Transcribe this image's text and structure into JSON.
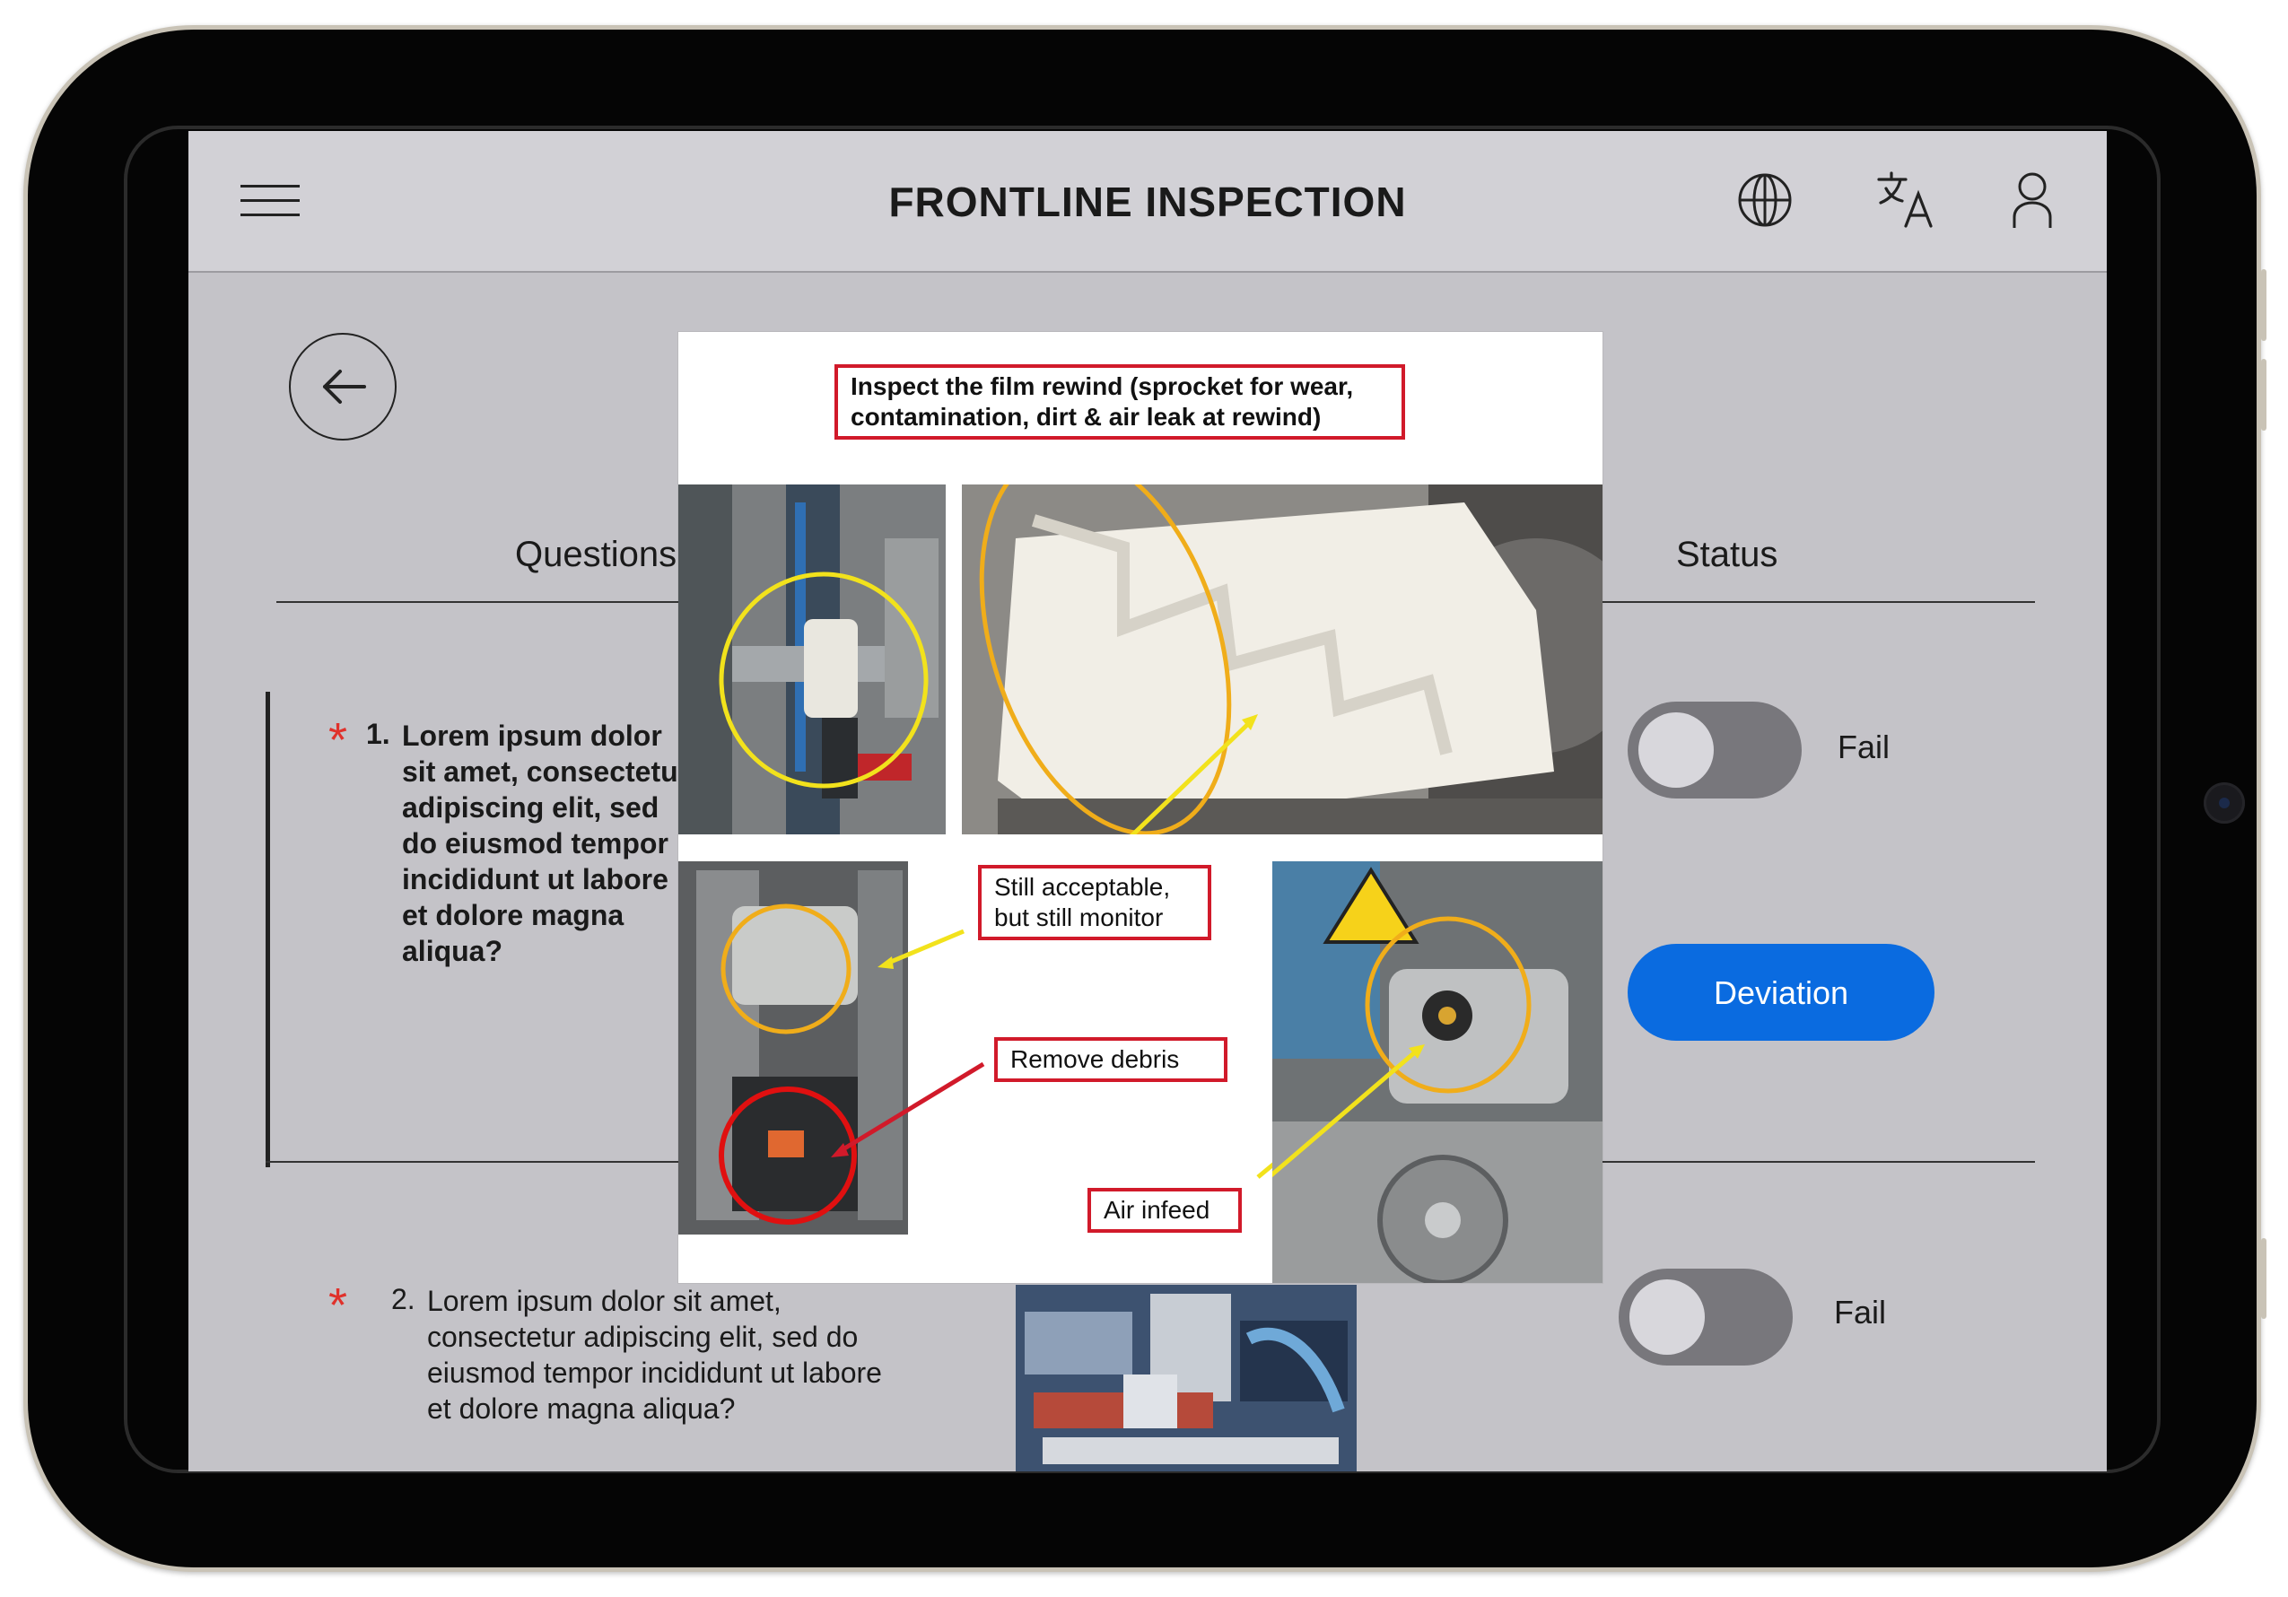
{
  "header": {
    "title": "FRONTLINE INSPECTION",
    "icons": [
      "menu-icon",
      "globe-icon",
      "translate-icon",
      "user-icon"
    ]
  },
  "table": {
    "questions_header": "Questions",
    "status_header": "Status"
  },
  "questions": [
    {
      "number": "1.",
      "text": "Lorem ipsum dolor sit amet, consectetur adipiscing elit, sed do eiusmod tempor incididunt ut labore et dolore magna aliqua?",
      "required": true,
      "toggle_on": false,
      "status": "Fail",
      "action_label": "Deviation"
    },
    {
      "number": "2.",
      "text": "Lorem ipsum dolor sit amet, consectetur adipiscing elit, sed do eiusmod tempor incididunt ut labore et dolore magna aliqua?",
      "required": true,
      "toggle_on": false,
      "status": "Fail"
    }
  ],
  "required_marker": "*",
  "popup": {
    "title": "Inspect the film rewind (sprocket for wear, contamination, dirt & air leak at rewind)",
    "callouts": {
      "acceptable": "Still acceptable, but still monitor",
      "debris": "Remove debris",
      "air": "Air infeed"
    }
  },
  "colors": {
    "accent": "#0a6be0",
    "required": "#e0312b",
    "callout_border": "#d11a2a",
    "marker_yellow": "#f2e21c",
    "marker_orange": "#f0ad1a",
    "marker_red": "#e01010"
  }
}
